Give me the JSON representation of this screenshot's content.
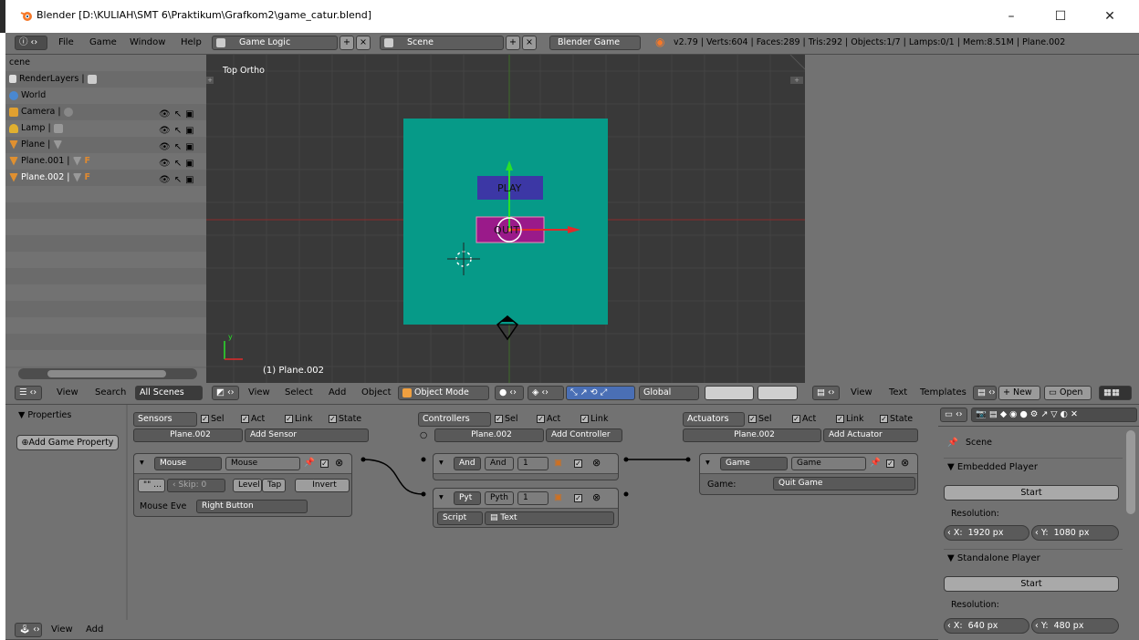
{
  "window": {
    "title": "Blender [D:\\KULIAH\\SMT 6\\Praktikum\\Grafkom2\\game_catur.blend]",
    "minimize": "–",
    "maximize": "☐",
    "close": "✕"
  },
  "infobar": {
    "menu": [
      "File",
      "Game",
      "Window",
      "Help"
    ],
    "screen_layout": "Game Logic",
    "scene": "Scene",
    "engine": "Blender Game",
    "stats": "v2.79 | Verts:604 | Faces:289 | Tris:292 | Objects:1/7 | Lamps:0/1 | Mem:8.51M | Plane.002"
  },
  "outliner": {
    "rows": [
      {
        "label": "cene"
      },
      {
        "label": "RenderLayers"
      },
      {
        "label": "World"
      },
      {
        "label": "Camera"
      },
      {
        "label": "Lamp"
      },
      {
        "label": "Plane"
      },
      {
        "label": "Plane.001"
      },
      {
        "label": "Plane.002"
      }
    ],
    "header": {
      "view": "View",
      "search": "Search",
      "filter": "All Scenes"
    }
  },
  "viewport": {
    "view_label": "Top Ortho",
    "object_label": "(1) Plane.002",
    "play_text": "PLAY",
    "quit_text": "QUIT",
    "colors": {
      "background": "#393939",
      "plane": "#069a88",
      "play": "#3c37a5",
      "quit": "#9a1a8a"
    },
    "header": {
      "menu": [
        "View",
        "Select",
        "Add",
        "Object"
      ],
      "mode": "Object Mode",
      "orientation": "Global"
    }
  },
  "text_editor_header": {
    "menu": [
      "View",
      "Text",
      "Templates"
    ],
    "new": "New",
    "open": "Open"
  },
  "logic": {
    "properties_title": "Properties",
    "add_game_property": "Add Game Property",
    "sensors": {
      "title": "Sensors",
      "flags": [
        "Sel",
        "Act",
        "Link",
        "State"
      ],
      "object": "Plane.002",
      "add": "Add Sensor",
      "brick": {
        "type": "Mouse",
        "name": "Mouse",
        "skip_label": "Skip:",
        "skip_value": "0",
        "level": "Level",
        "tap": "Tap",
        "invert": "Invert",
        "event_label": "Mouse Eve",
        "event_value": "Right Button"
      }
    },
    "controllers": {
      "title": "Controllers",
      "flags": [
        "Sel",
        "Act",
        "Link"
      ],
      "object": "Plane.002",
      "add": "Add Controller",
      "bricks": [
        {
          "type": "And",
          "name": "And",
          "state": "1"
        },
        {
          "type": "Pyt",
          "name": "Pyth",
          "state": "1",
          "mode": "Script",
          "script": "Text"
        }
      ]
    },
    "actuators": {
      "title": "Actuators",
      "flags": [
        "Sel",
        "Act",
        "Link",
        "State"
      ],
      "object": "Plane.002",
      "add": "Add Actuator",
      "brick": {
        "type": "Game",
        "name": "Game",
        "label": "Game:",
        "value": "Quit Game"
      }
    }
  },
  "properties_panel": {
    "scene_label": "Scene",
    "embedded": {
      "title": "Embedded Player",
      "start": "Start",
      "resolution": "Resolution:",
      "x_label": "X:",
      "x": "1920 px",
      "y_label": "Y:",
      "y": "1080 px"
    },
    "standalone": {
      "title": "Standalone Player",
      "start": "Start",
      "resolution": "Resolution:",
      "x_label": "X:",
      "x": "640 px",
      "y_label": "Y:",
      "y": "480 px"
    }
  },
  "bottombar": {
    "menu": [
      "View",
      "Add"
    ]
  }
}
